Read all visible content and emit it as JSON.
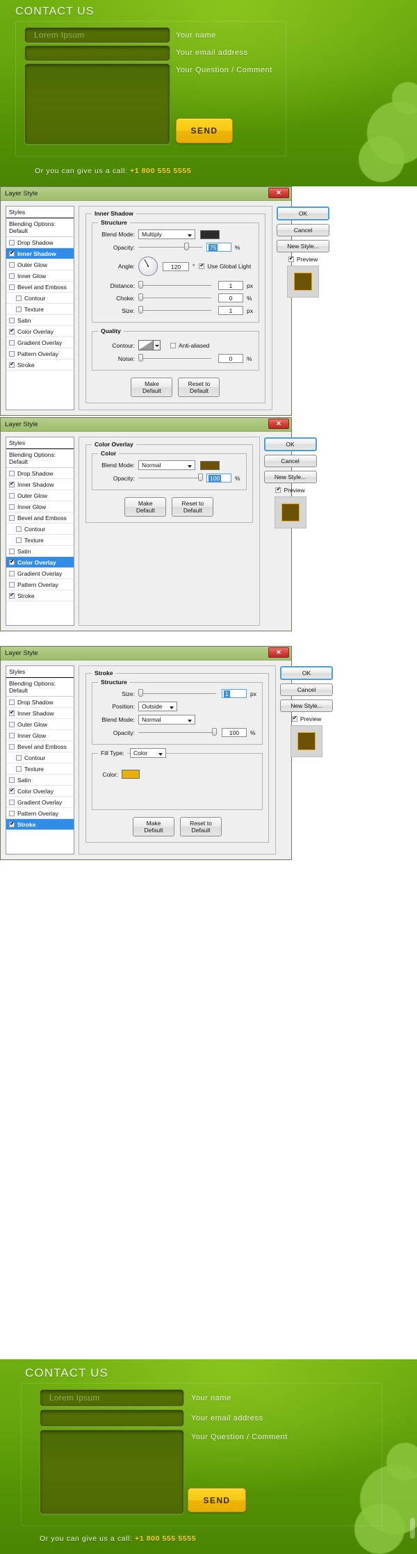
{
  "mockup": {
    "title": "CONTACT US",
    "fields": [
      {
        "placeholder": "Lorem Ipsum",
        "label": "Your name"
      },
      {
        "placeholder": "",
        "label": "Your email address"
      },
      {
        "placeholder": "",
        "label": "Your Question / Comment"
      }
    ],
    "send_label": "SEND",
    "callout_text": "Or you can give us a call:",
    "callout_phone": "+1 800 555 5555"
  },
  "colors": {
    "accent_green": "#6fae10",
    "field_green": "#506c05",
    "send_yellow": "#f7c914",
    "phone_yellow": "#ffd11a",
    "stroke_color": "#e8b00d",
    "overlay_color": "#6b5205",
    "shadow_color": "#2b2b2b",
    "selection_blue": "#2f8ce8"
  },
  "dialogs": [
    {
      "title": "Layer Style",
      "close_label": "✕",
      "styles_header": "Styles",
      "blending_options": "Blending Options: Default",
      "style_items": [
        {
          "label": "Drop Shadow",
          "checked": false,
          "selected": false,
          "indent": false
        },
        {
          "label": "Inner Shadow",
          "checked": true,
          "selected": true,
          "indent": false
        },
        {
          "label": "Outer Glow",
          "checked": false,
          "selected": false,
          "indent": false
        },
        {
          "label": "Inner Glow",
          "checked": false,
          "selected": false,
          "indent": false
        },
        {
          "label": "Bevel and Emboss",
          "checked": false,
          "selected": false,
          "indent": false
        },
        {
          "label": "Contour",
          "checked": false,
          "selected": false,
          "indent": true
        },
        {
          "label": "Texture",
          "checked": false,
          "selected": false,
          "indent": true
        },
        {
          "label": "Satin",
          "checked": false,
          "selected": false,
          "indent": false
        },
        {
          "label": "Color Overlay",
          "checked": true,
          "selected": false,
          "indent": false
        },
        {
          "label": "Gradient Overlay",
          "checked": false,
          "selected": false,
          "indent": false
        },
        {
          "label": "Pattern Overlay",
          "checked": false,
          "selected": false,
          "indent": false
        },
        {
          "label": "Stroke",
          "checked": true,
          "selected": false,
          "indent": false
        }
      ],
      "section_title": "Inner Shadow",
      "sub_title": "Structure",
      "blend_mode_label": "Blend Mode:",
      "blend_mode_value": "Multiply",
      "blend_color": "#2b2b2b",
      "opacity_label": "Opacity:",
      "opacity_value": "75",
      "opacity_unit": "%",
      "angle_label": "Angle:",
      "angle_value": "120",
      "angle_unit": "°",
      "global_light_label": "Use Global Light",
      "global_light_checked": true,
      "distance_label": "Distance:",
      "distance_value": "1",
      "distance_unit": "px",
      "choke_label": "Choke:",
      "choke_value": "0",
      "choke_unit": "%",
      "size_label": "Size:",
      "size_value": "1",
      "size_unit": "px",
      "quality_title": "Quality",
      "contour_label": "Contour:",
      "antialiased_label": "Anti-aliased",
      "antialiased_checked": false,
      "noise_label": "Noise:",
      "noise_value": "0",
      "noise_unit": "%",
      "make_default": "Make Default",
      "reset_default": "Reset to Default",
      "ok": "OK",
      "cancel": "Cancel",
      "new_style": "New Style...",
      "preview_label": "Preview",
      "preview_checked": true
    },
    {
      "title": "Layer Style",
      "close_label": "✕",
      "styles_header": "Styles",
      "blending_options": "Blending Options: Default",
      "style_items": [
        {
          "label": "Drop Shadow",
          "checked": false,
          "selected": false,
          "indent": false
        },
        {
          "label": "Inner Shadow",
          "checked": true,
          "selected": false,
          "indent": false
        },
        {
          "label": "Outer Glow",
          "checked": false,
          "selected": false,
          "indent": false
        },
        {
          "label": "Inner Glow",
          "checked": false,
          "selected": false,
          "indent": false
        },
        {
          "label": "Bevel and Emboss",
          "checked": false,
          "selected": false,
          "indent": false
        },
        {
          "label": "Contour",
          "checked": false,
          "selected": false,
          "indent": true
        },
        {
          "label": "Texture",
          "checked": false,
          "selected": false,
          "indent": true
        },
        {
          "label": "Satin",
          "checked": false,
          "selected": false,
          "indent": false
        },
        {
          "label": "Color Overlay",
          "checked": true,
          "selected": true,
          "indent": false
        },
        {
          "label": "Gradient Overlay",
          "checked": false,
          "selected": false,
          "indent": false
        },
        {
          "label": "Pattern Overlay",
          "checked": false,
          "selected": false,
          "indent": false
        },
        {
          "label": "Stroke",
          "checked": true,
          "selected": false,
          "indent": false
        }
      ],
      "section_title": "Color Overlay",
      "sub_title": "Color",
      "blend_mode_label": "Blend Mode:",
      "blend_mode_value": "Normal",
      "blend_color": "#6b5205",
      "opacity_label": "Opacity:",
      "opacity_value": "100",
      "opacity_unit": "%",
      "make_default": "Make Default",
      "reset_default": "Reset to Default",
      "ok": "OK",
      "cancel": "Cancel",
      "new_style": "New Style...",
      "preview_label": "Preview",
      "preview_checked": true
    },
    {
      "title": "Layer Style",
      "close_label": "✕",
      "styles_header": "Styles",
      "blending_options": "Blending Options: Default",
      "style_items": [
        {
          "label": "Drop Shadow",
          "checked": false,
          "selected": false,
          "indent": false
        },
        {
          "label": "Inner Shadow",
          "checked": true,
          "selected": false,
          "indent": false
        },
        {
          "label": "Outer Glow",
          "checked": false,
          "selected": false,
          "indent": false
        },
        {
          "label": "Inner Glow",
          "checked": false,
          "selected": false,
          "indent": false
        },
        {
          "label": "Bevel and Emboss",
          "checked": false,
          "selected": false,
          "indent": false
        },
        {
          "label": "Contour",
          "checked": false,
          "selected": false,
          "indent": true
        },
        {
          "label": "Texture",
          "checked": false,
          "selected": false,
          "indent": true
        },
        {
          "label": "Satin",
          "checked": false,
          "selected": false,
          "indent": false
        },
        {
          "label": "Color Overlay",
          "checked": true,
          "selected": false,
          "indent": false
        },
        {
          "label": "Gradient Overlay",
          "checked": false,
          "selected": false,
          "indent": false
        },
        {
          "label": "Pattern Overlay",
          "checked": false,
          "selected": false,
          "indent": false
        },
        {
          "label": "Stroke",
          "checked": true,
          "selected": true,
          "indent": false
        }
      ],
      "section_title": "Stroke",
      "sub_title": "Structure",
      "size_label": "Size:",
      "size_value": "1",
      "size_unit": "px",
      "position_label": "Position:",
      "position_value": "Outside",
      "blend_mode_label": "Blend Mode:",
      "blend_mode_value": "Normal",
      "opacity_label": "Opacity:",
      "opacity_value": "100",
      "opacity_unit": "%",
      "fill_type_label": "Fill Type:",
      "fill_type_value": "Color",
      "color_label": "Color:",
      "stroke_color": "#e8b00d",
      "make_default": "Make Default",
      "reset_default": "Reset to Default",
      "ok": "OK",
      "cancel": "Cancel",
      "new_style": "New Style...",
      "preview_label": "Preview",
      "preview_checked": true
    }
  ]
}
